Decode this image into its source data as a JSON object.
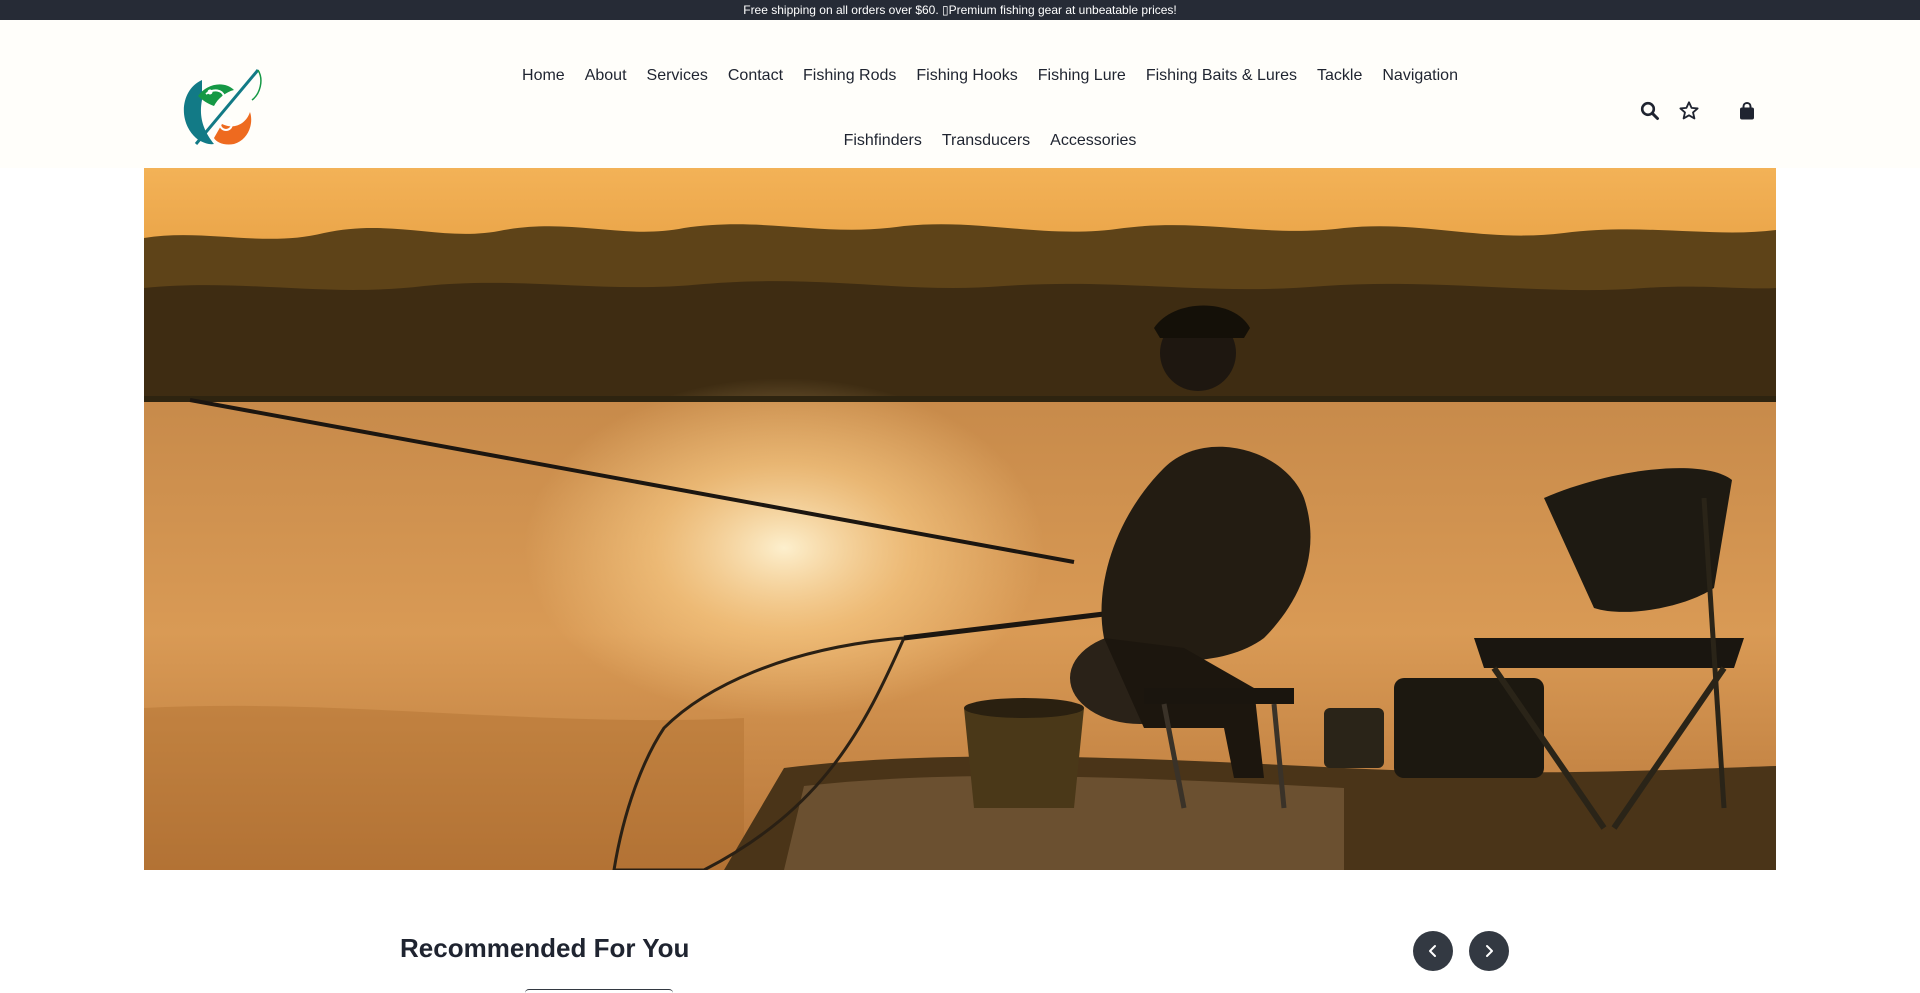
{
  "announcement": {
    "text": "Free shipping on all orders over $60. ▯Premium fishing gear at unbeatable prices!"
  },
  "logo": {
    "alt": "fishing-logo",
    "colors": {
      "teal": "#127a86",
      "orange": "#ee6a1f",
      "green": "#159845"
    }
  },
  "nav": {
    "row1": [
      "Home",
      "About",
      "Services",
      "Contact",
      "Fishing Rods",
      "Fishing Hooks",
      "Fishing Lure",
      "Fishing Baits & Lures",
      "Tackle",
      "Navigation"
    ],
    "row2": [
      "Fishfinders",
      "Transducers",
      "Accessories"
    ]
  },
  "header_actions": {
    "icons": [
      "search-icon",
      "star-icon",
      "bag-icon"
    ]
  },
  "hero": {
    "image_subject": "angler-at-sunset"
  },
  "recommended": {
    "title": "Recommended For You",
    "prev_icon": "chevron-left-icon",
    "next_icon": "chevron-right-icon"
  },
  "colors": {
    "topbar": "#262b36",
    "header_bg": "#fffefa",
    "text": "#1f2430",
    "button": "#333942"
  }
}
